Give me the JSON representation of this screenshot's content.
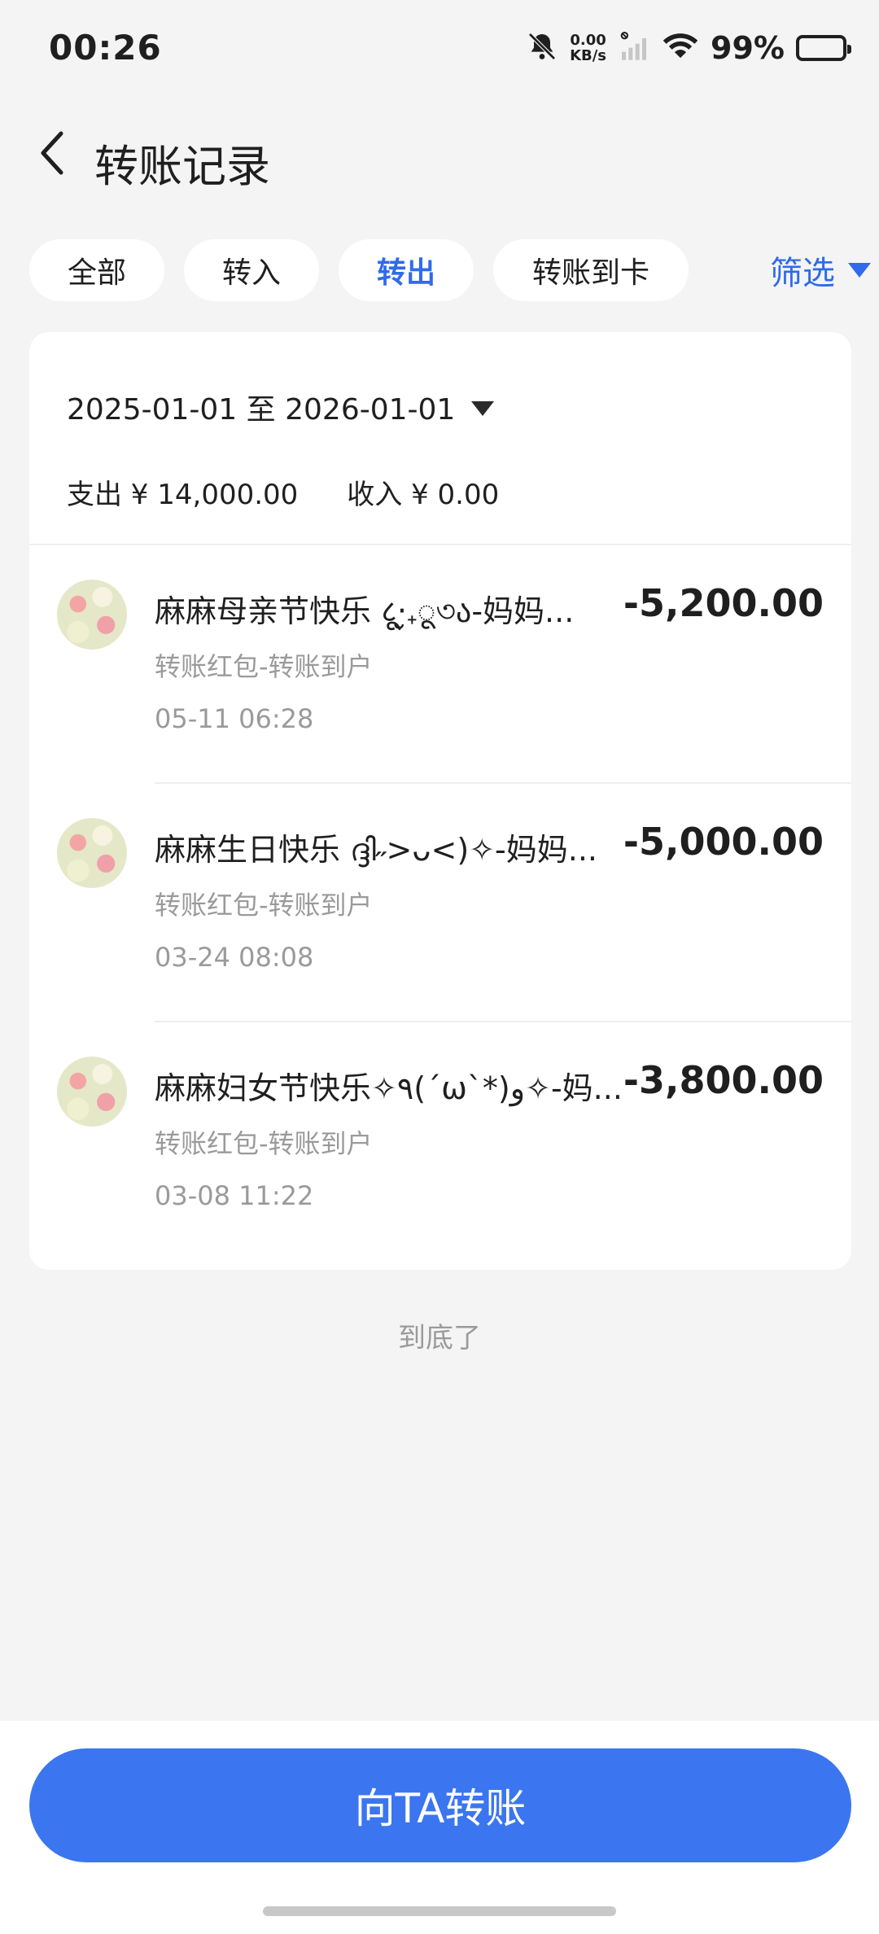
{
  "status_bar": {
    "time": "00:26",
    "net_speed_value": "0.00",
    "net_speed_unit": "KB/s",
    "battery": "99%",
    "battery_level": 0.99,
    "battery_color": "#3fcf4d"
  },
  "header": {
    "title": "转账记录",
    "back_icon": "chevron-left-icon"
  },
  "tabs": [
    {
      "label": "全部",
      "active": false
    },
    {
      "label": "转入",
      "active": false
    },
    {
      "label": "转出",
      "active": true
    },
    {
      "label": "转账到卡",
      "active": false
    }
  ],
  "filter": {
    "label": "筛选",
    "icon": "triangle-down-icon"
  },
  "summary": {
    "date_range": "2025-01-01 至 2026-01-01",
    "expense": "支出 ¥ 14,000.00",
    "income": "收入 ¥ 0.00"
  },
  "transactions": [
    {
      "title": "麻麻母亲节快乐 ८ू‧̮₊ू৩ა-妈妈...",
      "subtitle": "转账红包-转账到户",
      "time": "05-11 06:28",
      "amount": "-5,200.00"
    },
    {
      "title": "麻麻生日快乐 ദ്ദി˶>ᴗ<)✧-妈妈...",
      "subtitle": "转账红包-转账到户",
      "time": "03-24 08:08",
      "amount": "-5,000.00"
    },
    {
      "title": "麻麻妇女节快乐✧٩(ˊωˋ*)و✧-妈...",
      "subtitle": "转账红包-转账到户",
      "time": "03-08 11:22",
      "amount": "-3,800.00"
    }
  ],
  "end_text": "到底了",
  "primary_button": "向TA转账",
  "colors": {
    "accent": "#2f6bea",
    "button": "#3b76f0",
    "background": "#f4f4f4"
  }
}
